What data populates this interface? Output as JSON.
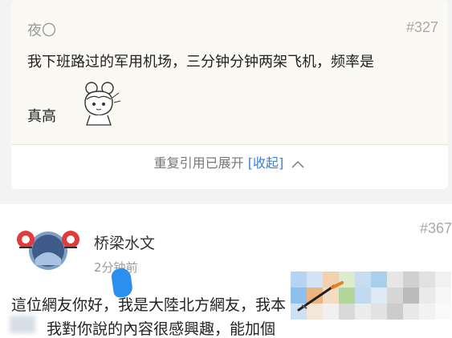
{
  "quote": {
    "author": "夜〇",
    "floor": "#327",
    "text_line1": "我下班路过的军用机场，三分钟分钟两架飞机，频率是",
    "text_line2": "真高",
    "collapse_prefix": "重复引用已展开",
    "collapse_link": "[收起]"
  },
  "post": {
    "username": "桥梁水文",
    "floor": "#367",
    "time": "2分钟前",
    "line1": "這位網友你好，我是大陸北方網友，我本",
    "line2": "我對你說的內容很感興趣，能加個"
  },
  "colors": {
    "link": "#3b7ed6",
    "quote_bg": "#fbf9f3",
    "blob": "#2c8ff0"
  },
  "icons": {
    "sticker": "anime-girl-sticker",
    "avatar": "user-avatar",
    "collapse": "chevron-up-icon"
  }
}
